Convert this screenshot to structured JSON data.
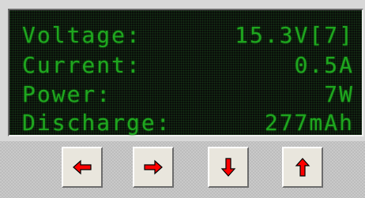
{
  "display": {
    "rows": [
      {
        "label": "Voltage:",
        "value": "15.3V[7]"
      },
      {
        "label": "Current:",
        "value": "0.5A"
      },
      {
        "label": "Power:",
        "value": "7W"
      },
      {
        "label": "Discharge:",
        "value": "277mAh"
      }
    ],
    "text_color": "#1fa61f"
  },
  "buttons": [
    {
      "icon": "arrow-left-icon"
    },
    {
      "icon": "arrow-right-icon"
    },
    {
      "icon": "arrow-down-icon"
    },
    {
      "icon": "arrow-up-icon"
    }
  ],
  "colors": {
    "arrow_fill": "#ff0000",
    "arrow_outline": "#000000",
    "button_face": "#e9e6dd"
  }
}
